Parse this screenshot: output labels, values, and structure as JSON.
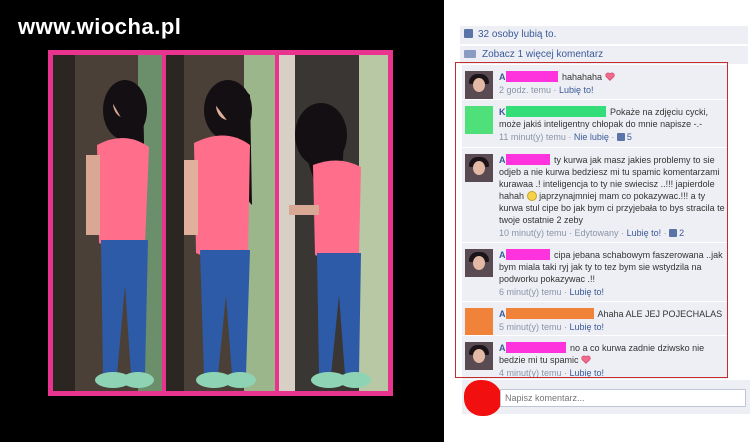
{
  "watermark": "www.wiocha.pl",
  "likes": {
    "text": "32 osoby lubią to."
  },
  "more_comments": {
    "text": "Zobacz 1 więcej komentarz"
  },
  "comments": [
    {
      "author_initial": "A",
      "author_redact_color": "#ff33dd",
      "text_before": "hahahaha",
      "has_heart": true,
      "text_after": "",
      "time": "2 godz. temu",
      "sep": " · ",
      "action": "Lubię to!",
      "avatar": "photo"
    },
    {
      "author_initial": "K",
      "author_redact_color": "#33dd77",
      "text_before": "Pokaże na zdjęciu cycki, może jakiś inteligentny chłopak do mnie napisze -.-",
      "has_heart": false,
      "text_after": "",
      "time": "11 minut(y) temu",
      "sep": " · ",
      "action": "Nie lubię",
      "likes": "5",
      "avatar": "green"
    },
    {
      "author_initial": "A",
      "author_redact_color": "#ff33dd",
      "text_before": "ty kurwa jak masz jakies problemy to sie odjeb a nie kurwa bedziesz mi tu spamic komentarzami kurawaa .! inteligencja to ty nie swiecisz ..!!! japierdole hahah",
      "has_smiley": true,
      "text_after": "japrzynajmniej mam co pokazywac.!!! a ty kurwa stul cipe bo jak bym ci przyjebała to bys stracila te twoje ostatnie 2 zeby",
      "time": "10 minut(y) temu",
      "sep": " · ",
      "edited": "Edytowany",
      "action": "Lubię to!",
      "likes": "2",
      "avatar": "photo"
    },
    {
      "author_initial": "A",
      "author_redact_color": "#ff33dd",
      "text_before": "cipa jebana schabowym faszerowana ..jak bym miala taki ryj jak ty to tez bym sie wstydzila na podworku pokazywac .!!",
      "has_heart": false,
      "text_after": "",
      "time": "6 minut(y) temu",
      "sep": " · ",
      "action": "Lubię to!",
      "avatar": "photo"
    },
    {
      "author_initial": "A",
      "author_redact_color": "#f0823a",
      "text_before": "Ahaha ALE JEJ POJECHALAS",
      "has_heart": false,
      "text_after": "",
      "time": "5 minut(y) temu",
      "sep": " · ",
      "action": "Lubię to!",
      "avatar": "orange"
    },
    {
      "author_initial": "A",
      "author_redact_color": "#ff33dd",
      "text_before": "no a co kurwa zadnie dziwsko nie bedzie mi tu spamic",
      "has_heart": true,
      "text_after": "",
      "time": "4 minut(y) temu",
      "sep": " · ",
      "action": "Lubię to!",
      "avatar": "photo"
    }
  ],
  "composer": {
    "placeholder": "Napisz komentarz..."
  },
  "colors": {
    "fb_blue": "#3b5998",
    "frame": "#e8338f",
    "highlight": "#c62b2b"
  },
  "icons": [
    "thumb-up-icon",
    "comment-icon",
    "heart-icon",
    "smiley-icon"
  ]
}
